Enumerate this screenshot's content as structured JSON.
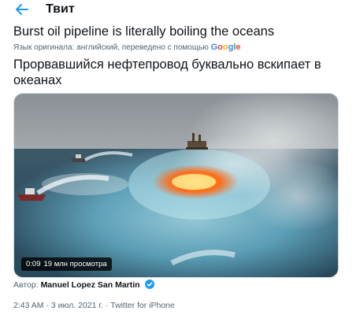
{
  "header": {
    "title": "Твит"
  },
  "tweet": {
    "original_text": "Burst oil pipeline is literally boiling the oceans",
    "translation_note": "Язык оригинала: английский, переведено с помощью",
    "translation_provider": "Google",
    "translated_text": "Прорвавшийся нефтепровод буквально вскипает в океанах",
    "video": {
      "duration": "0:09",
      "views": "19 млн просмотра"
    },
    "author_label": "Автор:",
    "author_name": "Manuel Lopez San Martin",
    "meta": "2:43 AM · 3 июл. 2021 г. · Twitter for iPhone"
  },
  "icons": {
    "back": "arrow-left-icon",
    "verified": "verified-badge-icon"
  },
  "colors": {
    "accent": "#1d9bf0",
    "text": "#0f1419",
    "secondary": "#536471"
  }
}
